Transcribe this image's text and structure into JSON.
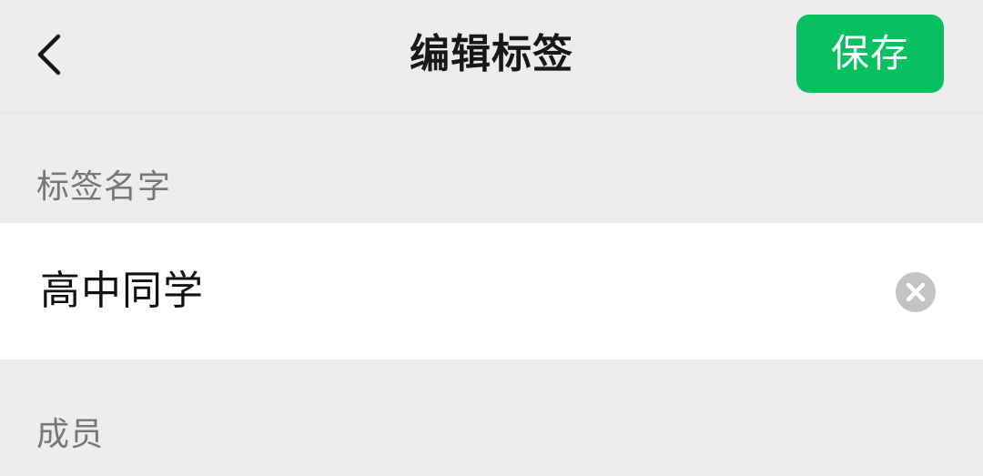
{
  "navbar": {
    "back_icon": "chevron-left-icon",
    "title": "编辑标签",
    "save_label": "保存",
    "save_color": "#07c160"
  },
  "tag_name_section": {
    "label": "标签名字",
    "input_value": "高中同学",
    "clear_icon": "clear-circle-icon"
  },
  "members_section": {
    "label": "成员"
  }
}
